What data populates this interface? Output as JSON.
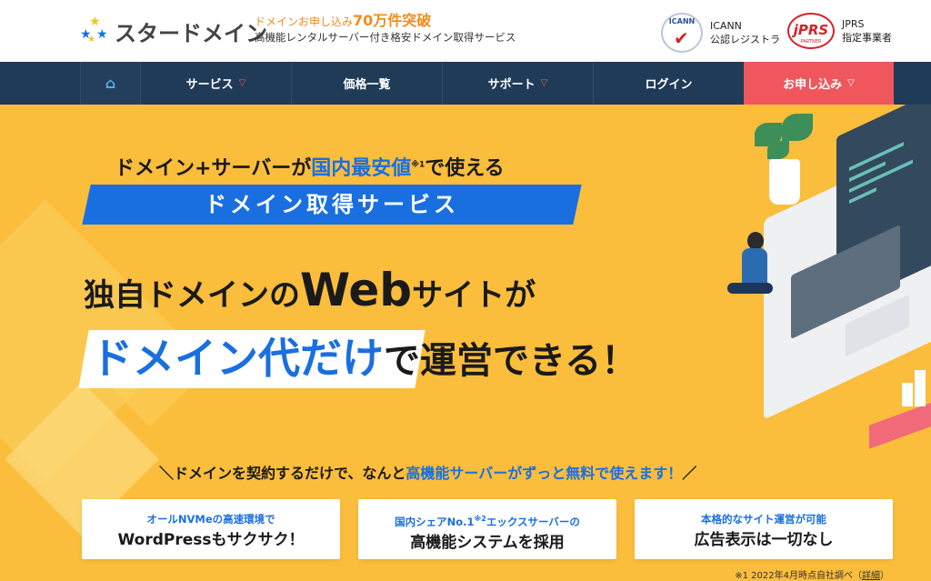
{
  "header": {
    "logo_text": "スタードメイン",
    "tagline_prefix": "ドメインお申し込み",
    "tagline_count": "70万件突破",
    "tagline_sub": "高機能レンタルサーバー付き格安ドメイン取得サービス",
    "icann_seal_text": "ICANN",
    "icann_label_1": "ICANN",
    "icann_label_2": "公認レジストラ",
    "jprs_seal_text": "jPRS",
    "jprs_seal_sub": "PARTNER",
    "jprs_label_1": "JPRS",
    "jprs_label_2": "指定事業者"
  },
  "nav": {
    "home_icon": "home-icon",
    "items": [
      {
        "label": "サービス",
        "has_dropdown": true
      },
      {
        "label": "価格一覧",
        "has_dropdown": false
      },
      {
        "label": "サポート",
        "has_dropdown": true
      },
      {
        "label": "ログイン",
        "has_dropdown": false
      },
      {
        "label": "お申し込み",
        "has_dropdown": true
      }
    ]
  },
  "hero": {
    "line1_a": "ドメイン+サーバーが",
    "line1_b": "国内最安値",
    "line1_note": "※1",
    "line1_c": "で使える",
    "banner": "ドメイン取得サービス",
    "big1_a": "独自ドメインの",
    "big1_web": "Web",
    "big1_b": "サイトが",
    "big2_a": "ドメイン代だけ",
    "big2_b": "で運営できる！",
    "sub_a": "＼ドメインを契約するだけで、なんと",
    "sub_b": "高機能サーバーがずっと無料で使えます！",
    "sub_c": "／",
    "features": [
      {
        "top": "オールNVMeの高速環境で",
        "bottom": "WordPressもサクサク！"
      },
      {
        "top_a": "国内シェアNo.1",
        "top_note": "※2",
        "top_b": "エックスサーバーの",
        "bottom": "高機能システムを採用"
      },
      {
        "top": "本格的なサイト運営が可能",
        "bottom": "広告表示は一切なし"
      }
    ],
    "footnote": "※1 2022年4月時点自社調べ（",
    "footnote_link": "詳細",
    "footnote_end": "）"
  },
  "colors": {
    "nav_bg": "#1f3b57",
    "apply_bg": "#f0575d",
    "hero_bg": "#fbbd3c",
    "accent_blue": "#1a6fe0",
    "tagline_orange": "#f08d1c"
  }
}
